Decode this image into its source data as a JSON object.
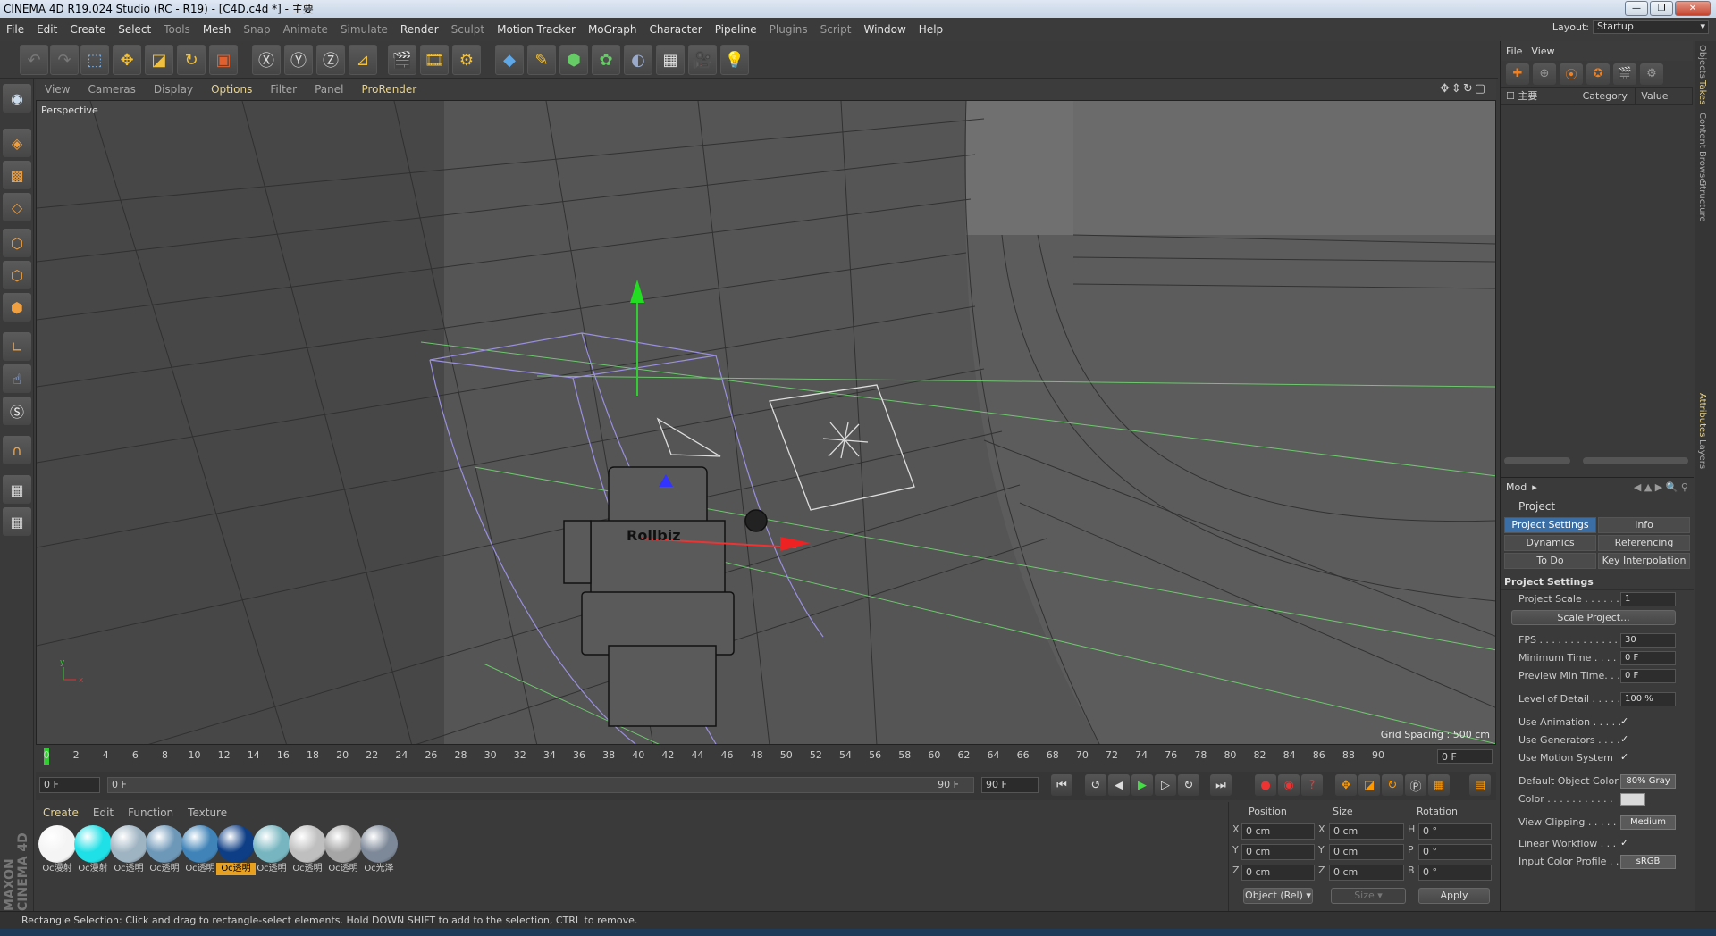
{
  "window": {
    "title": "CINEMA 4D R19.024 Studio (RC - R19) - [C4D.c4d *] - 主要",
    "buttons": [
      "—",
      "❐",
      "✕"
    ]
  },
  "menu": [
    {
      "label": "File",
      "dim": false
    },
    {
      "label": "Edit",
      "dim": false
    },
    {
      "label": "Create",
      "dim": false
    },
    {
      "label": "Select",
      "dim": false
    },
    {
      "label": "Tools",
      "dim": true
    },
    {
      "label": "Mesh",
      "dim": false
    },
    {
      "label": "Snap",
      "dim": true
    },
    {
      "label": "Animate",
      "dim": true
    },
    {
      "label": "Simulate",
      "dim": true
    },
    {
      "label": "Render",
      "dim": false
    },
    {
      "label": "Sculpt",
      "dim": true
    },
    {
      "label": "Motion Tracker",
      "dim": false
    },
    {
      "label": "MoGraph",
      "dim": false
    },
    {
      "label": "Character",
      "dim": false
    },
    {
      "label": "Pipeline",
      "dim": false
    },
    {
      "label": "Plugins",
      "dim": true
    },
    {
      "label": "Script",
      "dim": true
    },
    {
      "label": "Window",
      "dim": false
    },
    {
      "label": "Help",
      "dim": false
    }
  ],
  "layout": {
    "label": "Layout:",
    "value": "Startup"
  },
  "viewport": {
    "menu": [
      "View",
      "Cameras",
      "Display",
      "Options",
      "Filter",
      "Panel",
      "ProRender"
    ],
    "highlight": [
      "Options",
      "ProRender"
    ],
    "label": "Perspective",
    "grid_spacing": "Grid Spacing : 500 cm",
    "object_label": "Rollbiz"
  },
  "timeline": {
    "ticks": [
      "0",
      "2",
      "4",
      "6",
      "8",
      "10",
      "12",
      "14",
      "16",
      "18",
      "20",
      "22",
      "24",
      "26",
      "28",
      "30",
      "32",
      "34",
      "36",
      "38",
      "40",
      "42",
      "44",
      "46",
      "48",
      "50",
      "52",
      "54",
      "56",
      "58",
      "60",
      "62",
      "64",
      "66",
      "68",
      "70",
      "72",
      "74",
      "76",
      "78",
      "80",
      "82",
      "84",
      "86",
      "88",
      "90"
    ],
    "current": "0 F",
    "start": "0 F",
    "range_start": "0 F",
    "range_end": "90 F",
    "end": "90 F"
  },
  "materials": {
    "menu": [
      "Create",
      "Edit",
      "Function",
      "Texture"
    ],
    "items": [
      {
        "label": "Oc漫射",
        "color": "#f4f4f4",
        "selected": false
      },
      {
        "label": "Oc漫射",
        "color": "#1ee0e6",
        "selected": false
      },
      {
        "label": "Oc透明",
        "color": "#9fb4c2",
        "selected": false
      },
      {
        "label": "Oc透明",
        "color": "#6e98b8",
        "selected": false
      },
      {
        "label": "Oc透明",
        "color": "#3f83b8",
        "selected": false
      },
      {
        "label": "Oc透明",
        "color": "#0d3e86",
        "selected": true
      },
      {
        "label": "Oc透明",
        "color": "#77b6c0",
        "selected": false
      },
      {
        "label": "Oc透明",
        "color": "#bfbfbf",
        "selected": false
      },
      {
        "label": "Oc透明",
        "color": "#a6a6a6",
        "selected": false
      },
      {
        "label": "Oc光泽",
        "color": "#7d8898",
        "selected": false
      }
    ]
  },
  "coords": {
    "headers": [
      "Position",
      "Size",
      "Rotation"
    ],
    "rows": [
      {
        "axis": "X",
        "pos": "0 cm",
        "saxis": "X",
        "size": "0 cm",
        "raxis": "H",
        "rot": "0 °"
      },
      {
        "axis": "Y",
        "pos": "0 cm",
        "saxis": "Y",
        "size": "0 cm",
        "raxis": "P",
        "rot": "0 °"
      },
      {
        "axis": "Z",
        "pos": "0 cm",
        "saxis": "Z",
        "size": "0 cm",
        "raxis": "B",
        "rot": "0 °"
      }
    ],
    "mode": "Object (Rel)",
    "size_mode": "Size",
    "apply": "Apply"
  },
  "status": "Rectangle Selection: Click and drag to rectangle-select elements. Hold DOWN SHIFT to add to the selection, CTRL to remove.",
  "brand": "MAXON CINEMA 4D",
  "takes": {
    "menu": [
      "File",
      "View"
    ],
    "col_main": "主要",
    "col_category": "Category",
    "col_value": "Value"
  },
  "attributes": {
    "mode": "Mod",
    "title": "Project",
    "tabs": [
      "Project Settings",
      "Info",
      "Dynamics",
      "Referencing",
      "To Do",
      "Key Interpolation"
    ],
    "section": "Project Settings",
    "rows": [
      {
        "label": "Project Scale . . . . . .",
        "type": "val",
        "value": "1"
      },
      {
        "label": "",
        "type": "button",
        "value": "Scale Project..."
      },
      {
        "label": "FPS . . . . . . . . . . . . . .",
        "type": "val",
        "value": "30"
      },
      {
        "label": "Minimum Time . . . . .",
        "type": "val",
        "value": "0 F"
      },
      {
        "label": "Preview Min Time. . .",
        "type": "val",
        "value": "0 F"
      },
      {
        "label": "Level of Detail . . . . .",
        "type": "val",
        "value": "100 %"
      },
      {
        "label": "Use Animation . . . . .",
        "type": "check",
        "value": "✓"
      },
      {
        "label": "Use Generators . . . .",
        "type": "check",
        "value": "✓"
      },
      {
        "label": "Use Motion System",
        "type": "check",
        "value": "✓"
      },
      {
        "label": "Default Object Color",
        "type": "valb",
        "value": "80% Gray"
      },
      {
        "label": "Color . . . . . . . . . . .",
        "type": "swatch",
        "value": ""
      },
      {
        "label": "View Clipping . . . . .",
        "type": "valb",
        "value": "Medium"
      },
      {
        "label": "Linear Workflow . . .",
        "type": "check",
        "value": "✓"
      },
      {
        "label": "Input Color Profile . .",
        "type": "valb",
        "value": "sRGB"
      }
    ]
  },
  "side_tabs": [
    "Objects",
    "Takes",
    "Content Browser",
    "Structure",
    "Attributes",
    "Layers"
  ]
}
